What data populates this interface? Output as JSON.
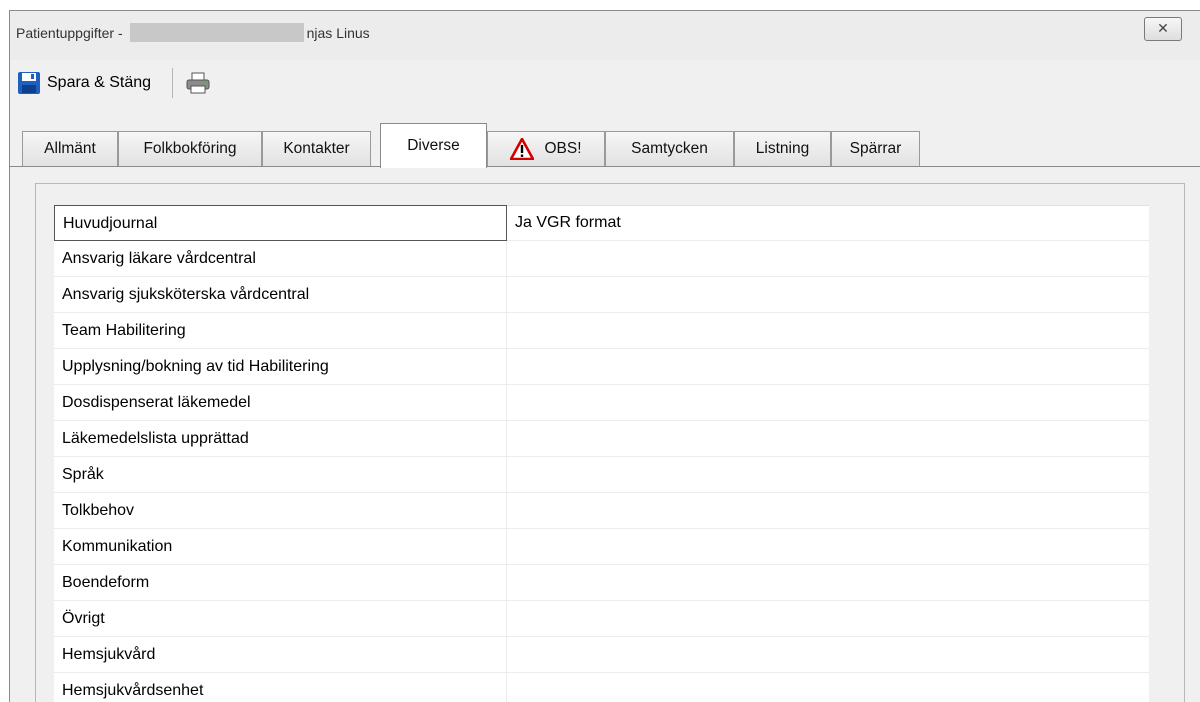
{
  "window": {
    "title_prefix": "Patientuppgifter -",
    "title_suffix": "njas Linus",
    "close_glyph": "✕"
  },
  "toolbar": {
    "save_label": "Spara & Stäng",
    "save_icon": "floppy-disk-icon",
    "print_icon": "printer-icon"
  },
  "tabs": [
    {
      "label": "Allmänt",
      "active": false
    },
    {
      "label": "Folkbokföring",
      "active": false
    },
    {
      "label": "Kontakter",
      "active": false
    },
    {
      "label": "Diverse",
      "active": true
    },
    {
      "label": "OBS!",
      "active": false,
      "icon": "warning-icon"
    },
    {
      "label": "Samtycken",
      "active": false
    },
    {
      "label": "Listning",
      "active": false
    },
    {
      "label": "Spärrar",
      "active": false
    }
  ],
  "rows": [
    {
      "label": "Huvudjournal",
      "value": "Ja VGR format"
    },
    {
      "label": "Ansvarig läkare vårdcentral",
      "value": ""
    },
    {
      "label": "Ansvarig sjuksköterska vårdcentral",
      "value": ""
    },
    {
      "label": "Team Habilitering",
      "value": ""
    },
    {
      "label": "Upplysning/bokning av tid Habilitering",
      "value": ""
    },
    {
      "label": "Dosdispenserat läkemedel",
      "value": ""
    },
    {
      "label": "Läkemedelslista upprättad",
      "value": ""
    },
    {
      "label": "Språk",
      "value": ""
    },
    {
      "label": "Tolkbehov",
      "value": ""
    },
    {
      "label": "Kommunikation",
      "value": ""
    },
    {
      "label": "Boendeform",
      "value": ""
    },
    {
      "label": "Övrigt",
      "value": ""
    },
    {
      "label": "Hemsjukvård",
      "value": ""
    },
    {
      "label": "Hemsjukvårdsenhet",
      "value": ""
    }
  ],
  "colors": {
    "warning": "#d40000",
    "floppy": "#1f5fbf"
  }
}
